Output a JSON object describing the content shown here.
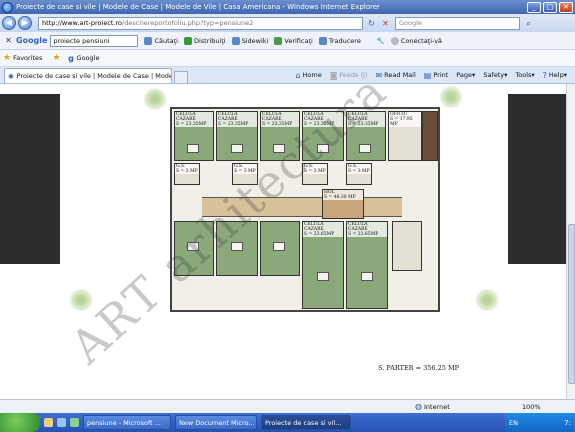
{
  "window": {
    "title": "Proiecte de case si vile | Modele de Case | Modele de Vile | Casa Americana - Windows Internet Explorer",
    "min": "_",
    "max": "□",
    "close": "✕"
  },
  "address": {
    "host": "http://www.art-proiect.ro",
    "rest": "/descriereportofoliu.php?typ=pensiune2",
    "search_placeholder": "Google"
  },
  "google_toolbar": {
    "logo": "Google",
    "query": "proiecte pensiuni",
    "search_label": "Căutaţi",
    "share_label": "Distribuiţi",
    "sidewiki_label": "Sidewiki",
    "check_label": "Verificaţi",
    "translate_label": "Traducere",
    "signin_label": "Conectaţi-vă"
  },
  "favorites": {
    "label": "Favorites",
    "google": "Google"
  },
  "tab": {
    "label": "Proiecte de case si vile | Modele de Case | Modele de ..."
  },
  "commands": {
    "home": "Home",
    "feeds": "Feeds (J)",
    "read_mail": "Read Mail",
    "print": "Print",
    "page": "Page",
    "safety": "Safety",
    "tools": "Tools",
    "help": "Help"
  },
  "plan": {
    "rooms": [
      {
        "label": "CELULA CAZARE",
        "area": "S = 23.35MP"
      },
      {
        "label": "CELULA CAZARE",
        "area": "S = 23.35MP"
      },
      {
        "label": "CELULA CAZARE",
        "area": "S = 23.35MP"
      },
      {
        "label": "CELULA CAZARE",
        "area": "S = 23.35MP"
      },
      {
        "label": "CELULA CAZARE",
        "area": "S = 23.35MP"
      },
      {
        "label": "OFICIU",
        "area": "S = 17.95 MP"
      },
      {
        "label": "HOL",
        "area": "S = 46.30 MP"
      },
      {
        "label": "CELULA CAZARE",
        "area": "S = 23.65MP"
      },
      {
        "label": "CELULA CAZARE",
        "area": "S = 23.65MP"
      }
    ],
    "small": [
      {
        "label": "G.S.",
        "area": "S = 3 MP"
      },
      {
        "label": "G.S.",
        "area": "S = 3 MP"
      },
      {
        "label": "G.S.",
        "area": "S = 3 MP"
      },
      {
        "label": "G.S.",
        "area": "S = 3 MP"
      }
    ],
    "total_label": "S. PARTER = 356.25 MP",
    "watermark": "ART arhitectura & design"
  },
  "status": {
    "zone": "Internet",
    "zoom": "100%"
  },
  "taskbar": {
    "tasks": [
      "pensiune - Microsoft ...",
      "New Document Micro...",
      "Proiecte de case si vil..."
    ],
    "lang": "EN",
    "clock": "7:"
  }
}
